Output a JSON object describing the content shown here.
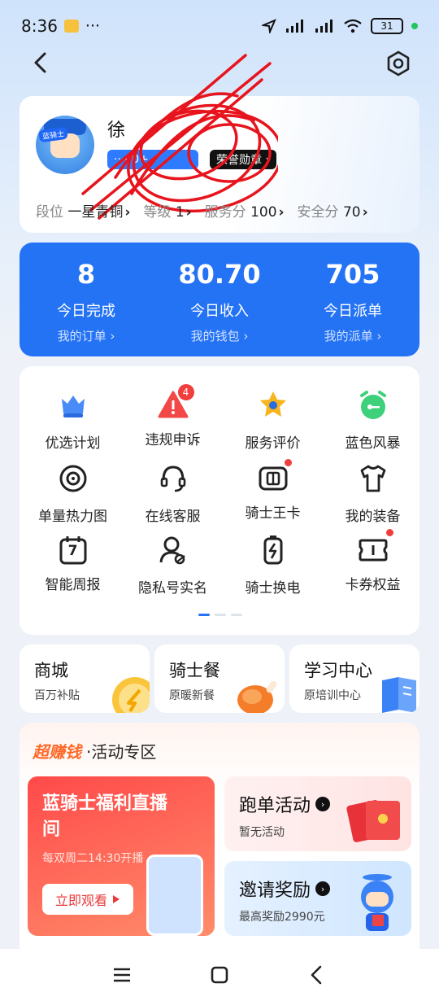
{
  "status_bar": {
    "time": "8:36",
    "more": "···",
    "battery": "31"
  },
  "profile": {
    "name": "徐",
    "pill_blue": "···00+ ›",
    "pill_dark": "荣誉勋章 ›",
    "avatar_badge": "蓝骑士",
    "stats": [
      {
        "label": "段位",
        "value": "一星青铜"
      },
      {
        "label": "等级",
        "value": "1"
      },
      {
        "label": "服务分",
        "value": "100"
      },
      {
        "label": "安全分",
        "value": "70"
      }
    ]
  },
  "summary": [
    {
      "number": "8",
      "label": "今日完成",
      "link": "我的订单 ›"
    },
    {
      "number": "80.70",
      "label": "今日收入",
      "link": "我的钱包 ›"
    },
    {
      "number": "705",
      "label": "今日派单",
      "link": "我的派单 ›"
    }
  ],
  "grid": [
    {
      "label": "优选计划",
      "icon": "crown-icon"
    },
    {
      "label": "违规申诉",
      "icon": "warning-icon",
      "badge": "4"
    },
    {
      "label": "服务评价",
      "icon": "star-badge-icon"
    },
    {
      "label": "蓝色风暴",
      "icon": "alarm-clock-icon"
    },
    {
      "label": "单量热力图",
      "icon": "target-icon"
    },
    {
      "label": "在线客服",
      "icon": "headset-icon"
    },
    {
      "label": "骑士王卡",
      "icon": "sim-card-icon"
    },
    {
      "label": "我的装备",
      "icon": "tshirt-icon"
    },
    {
      "label": "智能周报",
      "icon": "calendar-icon",
      "icon_text": "7"
    },
    {
      "label": "隐私号实名",
      "icon": "user-id-icon"
    },
    {
      "label": "骑士换电",
      "icon": "battery-swap-icon"
    },
    {
      "label": "卡券权益",
      "icon": "coupon-icon"
    }
  ],
  "shortcuts": [
    {
      "title": "商城",
      "sub": "百万补贴"
    },
    {
      "title": "骑士餐",
      "sub": "原暖新餐"
    },
    {
      "title": "学习中心",
      "sub": "原培训中心"
    }
  ],
  "activity": {
    "hot": "超赚钱",
    "title": "·活动专区",
    "live": {
      "title": "蓝骑士福利直播间",
      "sub": "每双周二14:30开播",
      "button": "立即观看"
    },
    "run": {
      "title": "跑单活动",
      "sub": "暂无活动"
    },
    "invite": {
      "title": "邀请奖励",
      "sub": "最高奖励2990元"
    }
  },
  "colors": {
    "accent": "#2473f5",
    "alert": "#f23d3d",
    "hot": "#ff6a2a"
  }
}
